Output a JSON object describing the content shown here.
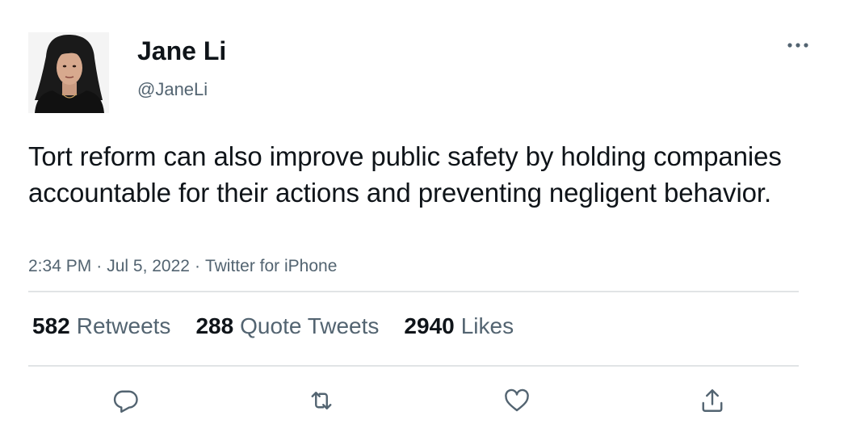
{
  "user": {
    "display_name": "Jane Li",
    "handle": "@JaneLi"
  },
  "tweet": {
    "text": "Tort reform can also improve public safety by holding companies accountable for their actions and preventing negligent behavior.",
    "time": "2:34 PM",
    "date": "Jul 5, 2022",
    "source": "Twitter for iPhone",
    "separator": "·"
  },
  "stats": {
    "retweets": {
      "count": "582",
      "label": "Retweets"
    },
    "quote_tweets": {
      "count": "288",
      "label": "Quote Tweets"
    },
    "likes": {
      "count": "2940",
      "label": "Likes"
    }
  },
  "icons": {
    "more": "more-horizontal-icon",
    "reply": "reply-icon",
    "retweet": "retweet-icon",
    "like": "heart-icon",
    "share": "share-icon"
  },
  "colors": {
    "text": "#0f1419",
    "secondary": "#536471",
    "divider": "#e1e4e6"
  }
}
